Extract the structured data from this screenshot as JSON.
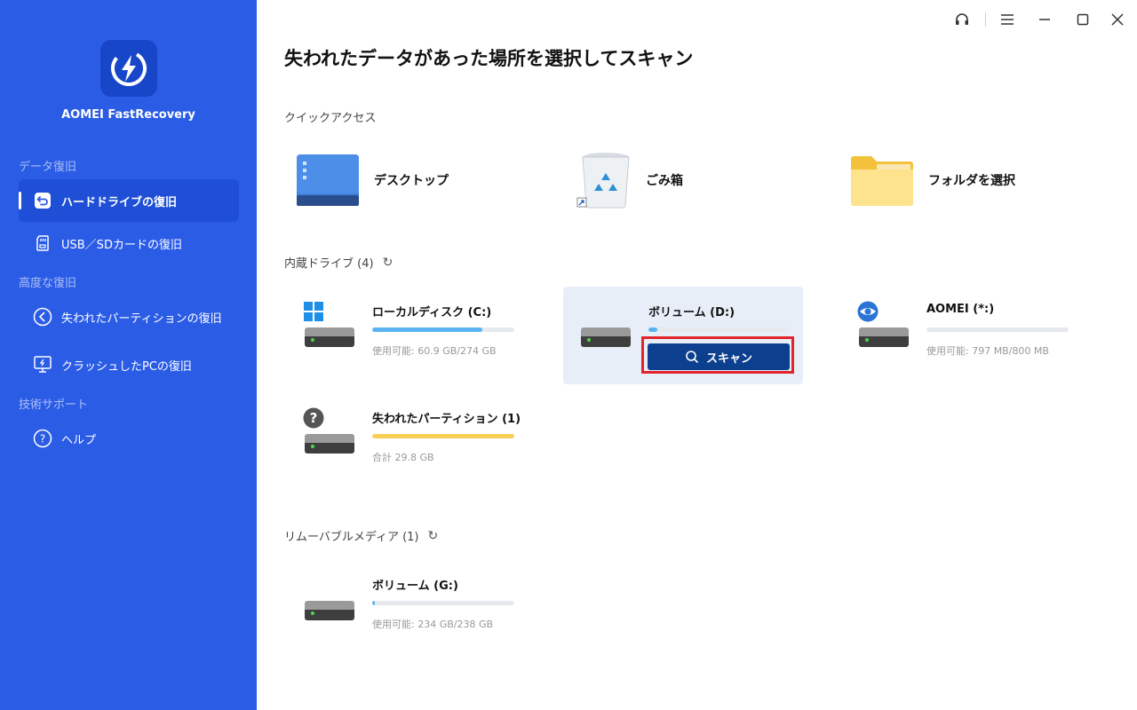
{
  "app": {
    "name": "AOMEI FastRecovery"
  },
  "sidebar": {
    "sections": [
      {
        "label": "データ復旧"
      },
      {
        "label": "高度な復旧"
      },
      {
        "label": "技術サポート"
      }
    ],
    "items": [
      {
        "label": "ハードドライブの復旧",
        "icon": "undo-arrow-icon",
        "active": true
      },
      {
        "label": "USB／SDカードの復旧",
        "icon": "sd-card-icon"
      },
      {
        "label": "失われたパーティションの復旧",
        "icon": "back-circle-icon"
      },
      {
        "label": "クラッシュしたPCの復旧",
        "icon": "monitor-flash-icon"
      },
      {
        "label": "ヘルプ",
        "icon": "help-circle-icon"
      }
    ]
  },
  "main": {
    "title": "失われたデータがあった場所を選択してスキャン",
    "quick_access": {
      "label": "クイックアクセス",
      "items": [
        {
          "label": "デスクトップ",
          "icon": "desktop-icon"
        },
        {
          "label": "ごみ箱",
          "icon": "recycle-bin-icon"
        },
        {
          "label": "フォルダを選択",
          "icon": "folder-icon"
        }
      ]
    },
    "internal": {
      "label": "内蔵ドライブ (4)",
      "drives": [
        {
          "name": "ローカルディスク (C:)",
          "info": "使用可能: 60.9 GB/274 GB",
          "fill_percent": 77.8,
          "color": "#5ab3f0",
          "badge": "windows-logo-icon"
        },
        {
          "name": "ボリューム (D:)",
          "fill_percent": 6,
          "color": "#5ab3f0",
          "scan_label": "スキャン",
          "selected": true
        },
        {
          "name": "AOMEI (*:)",
          "info": "使用可能: 797 MB/800 MB",
          "fill_percent": 0,
          "color": "#5ab3f0",
          "badge": "eye-icon"
        },
        {
          "name": "失われたパーティション (1)",
          "info": "合計 29.8 GB",
          "fill_percent": 100,
          "color": "#f9cf55",
          "badge": "question-icon"
        }
      ]
    },
    "removable": {
      "label": "リムーバブルメディア (1)",
      "drives": [
        {
          "name": "ボリューム (G:)",
          "info": "使用可能: 234 GB/238 GB",
          "fill_percent": 1.7,
          "color": "#5ab3f0"
        }
      ]
    }
  },
  "window_controls": [
    "headset-icon",
    "menu-icon",
    "minimize-icon",
    "maximize-icon",
    "close-icon"
  ]
}
